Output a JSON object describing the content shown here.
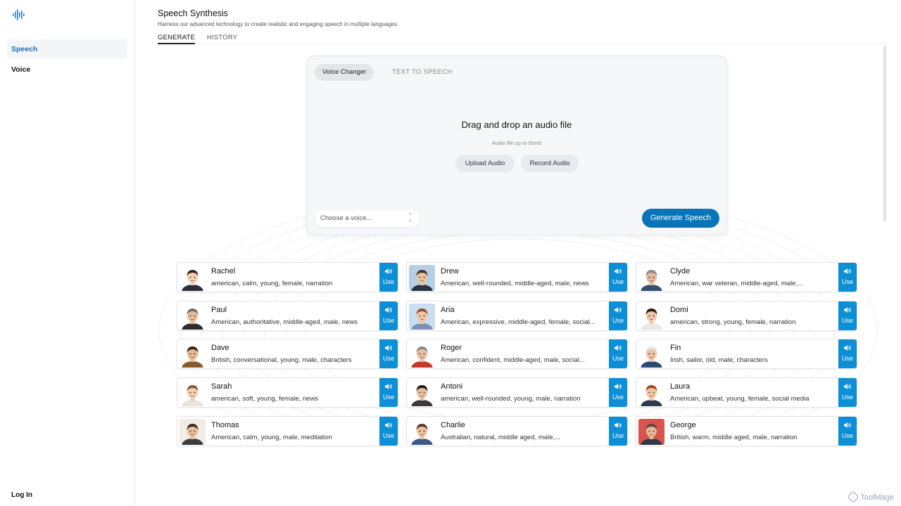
{
  "sidebar": {
    "logo_icon": "waveform-icon",
    "items": [
      {
        "label": "Speech",
        "active": true
      },
      {
        "label": "Voice",
        "active": false
      }
    ],
    "login_label": "Log In"
  },
  "header": {
    "title": "Speech Synthesis",
    "subtitle": "Harness our advanced technology to create realistic and engaging speech in multiple languages.",
    "tabs": [
      {
        "label": "GENERATE",
        "active": true
      },
      {
        "label": "HISTORY",
        "active": false
      }
    ]
  },
  "generator": {
    "mode_tabs": [
      {
        "label": "Voice Changer",
        "active": true
      },
      {
        "label": "TEXT TO SPEECH",
        "active": false
      }
    ],
    "drop_title": "Drag and drop an audio file",
    "drop_subtitle": "Audio file up to 50mb",
    "upload_label": "Upload Audio",
    "record_label": "Record Audio",
    "voice_select_placeholder": "Choose a voice...",
    "generate_label": "Generate Speech"
  },
  "voices": [
    {
      "name": "Rachel",
      "desc": "american, calm, young, female, narration",
      "use": "Use",
      "skin": "#f2d0b4",
      "hair": "#3a2418",
      "shirt": "#2b2f3a",
      "bg": "#ffffff"
    },
    {
      "name": "Drew",
      "desc": "American, well-rounded, middle-aged, male, news",
      "use": "Use",
      "skin": "#e9c3a2",
      "hair": "#4a3526",
      "shirt": "#2a3340",
      "bg": "#b7cfe4"
    },
    {
      "name": "Clyde",
      "desc": "American, war veteran, middle-aged, male,...",
      "use": "Use",
      "skin": "#e3b99a",
      "hair": "#8a8a8a",
      "shirt": "#33506e",
      "bg": "#ffffff"
    },
    {
      "name": "Paul",
      "desc": "American, authoritative, middle-aged, male, news",
      "use": "Use",
      "skin": "#e6bd9c",
      "hair": "#6e6e6e",
      "shirt": "#2e2e2e",
      "bg": "#ffffff"
    },
    {
      "name": "Aria",
      "desc": "American, expressive, middle-aged, female, social...",
      "use": "Use",
      "skin": "#f0c8a8",
      "hair": "#9a4a2a",
      "shirt": "#7e8fb8",
      "bg": "#c9def0"
    },
    {
      "name": "Domi",
      "desc": "american, strong, young, female, narration",
      "use": "Use",
      "skin": "#efc7a9",
      "hair": "#2a1a12",
      "shirt": "#e8e8e8",
      "bg": "#ffffff"
    },
    {
      "name": "Dave",
      "desc": "British, conversational, young, male, characters",
      "use": "Use",
      "skin": "#e6b892",
      "hair": "#3a2414",
      "shirt": "#8a5a2a",
      "bg": "#ffffff"
    },
    {
      "name": "Roger",
      "desc": "American, confident, middle-aged, male, social...",
      "use": "Use",
      "skin": "#e8bfa0",
      "hair": "#8c8c8c",
      "shirt": "#c23a2a",
      "bg": "#ffffff"
    },
    {
      "name": "Fin",
      "desc": "Irish, sailor, old, male, characters",
      "use": "Use",
      "skin": "#eac4a6",
      "hair": "#e6e6e6",
      "shirt": "#2c4a78",
      "bg": "#ffffff"
    },
    {
      "name": "Sarah",
      "desc": "american, soft, young, female, news",
      "use": "Use",
      "skin": "#f2cdb0",
      "hair": "#8a5230",
      "shirt": "#e6e2dc",
      "bg": "#ffffff"
    },
    {
      "name": "Antoni",
      "desc": "american, well-rounded, young, male, narration",
      "use": "Use",
      "skin": "#e8c0a0",
      "hair": "#1e1a18",
      "shirt": "#3a3a3a",
      "bg": "#ffffff"
    },
    {
      "name": "Laura",
      "desc": "American, upbeat, young, female, social media",
      "use": "Use",
      "skin": "#f0c6a4",
      "hair": "#a04a24",
      "shirt": "#2e3a50",
      "bg": "#ffffff"
    },
    {
      "name": "Thomas",
      "desc": "American, calm, young, male, meditation",
      "use": "Use",
      "skin": "#e6bd9a",
      "hair": "#3a2a1c",
      "shirt": "#3c3c3c",
      "bg": "#f1ece4"
    },
    {
      "name": "Charlie",
      "desc": "Australian, natural, middle aged, male,...",
      "use": "Use",
      "skin": "#eac2a0",
      "hair": "#5a3a24",
      "shirt": "#3a5a8a",
      "bg": "#ffffff"
    },
    {
      "name": "George",
      "desc": "British, warm, middle aged, male, narration",
      "use": "Use",
      "skin": "#e3b896",
      "hair": "#5a4a3e",
      "shirt": "#2e3a4a",
      "bg": "#d9534f"
    }
  ],
  "watermark": "ToolMage"
}
